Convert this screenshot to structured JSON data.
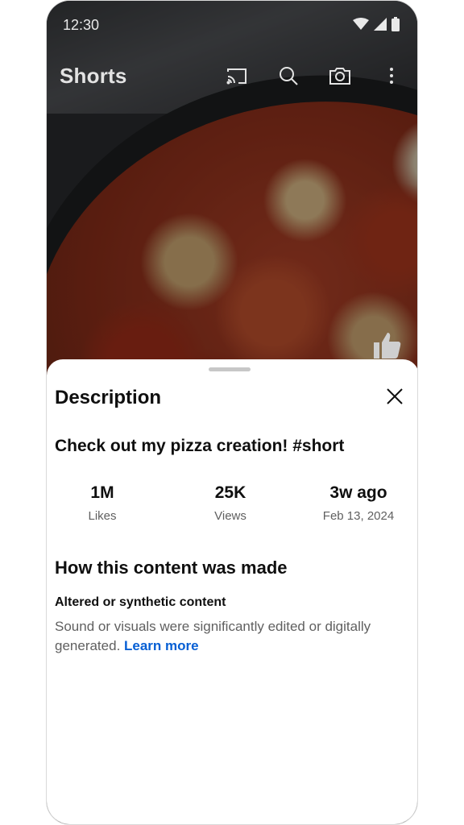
{
  "status_bar": {
    "time": "12:30"
  },
  "app_bar": {
    "title": "Shorts",
    "actions": [
      "cast-icon",
      "search-icon",
      "camera-icon",
      "more-vert-icon"
    ]
  },
  "sheet": {
    "title": "Description",
    "video_title": "Check out my pizza creation! #short",
    "stats": [
      {
        "value": "1M",
        "label": "Likes"
      },
      {
        "value": "25K",
        "label": "Views"
      },
      {
        "value": "3w ago",
        "label": "Feb 13, 2024"
      }
    ],
    "section_title": "How this content was made",
    "disclosure_title": "Altered or synthetic content",
    "disclosure_text": "Sound or visuals were significantly edited or digitally generated. ",
    "learn_more": "Learn more"
  },
  "colors": {
    "link": "#065fd4",
    "secondary_text": "#606060",
    "primary_text": "#0f0f0f"
  }
}
